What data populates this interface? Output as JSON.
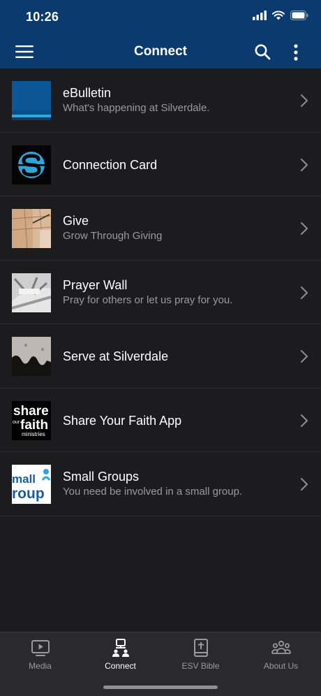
{
  "status": {
    "time": "10:26"
  },
  "header": {
    "title": "Connect"
  },
  "items": [
    {
      "title": "eBulletin",
      "subtitle": "What's happening at Silverdale."
    },
    {
      "title": "Connection Card",
      "subtitle": ""
    },
    {
      "title": "Give",
      "subtitle": "Grow Through Giving"
    },
    {
      "title": "Prayer Wall",
      "subtitle": "Pray for others or let us pray for you."
    },
    {
      "title": "Serve at Silverdale",
      "subtitle": ""
    },
    {
      "title": "Share Your Faith App",
      "subtitle": "",
      "thumb_text": [
        "share",
        "our",
        "faith",
        "ministries"
      ]
    },
    {
      "title": "Small Groups",
      "subtitle": "You need be involved in a small group.",
      "thumb_text": [
        "mall",
        "roup"
      ]
    }
  ],
  "tabs": [
    {
      "label": "Media",
      "icon": "play-icon"
    },
    {
      "label": "Connect",
      "icon": "connect-icon",
      "active": true
    },
    {
      "label": "ESV Bible",
      "icon": "bible-icon"
    },
    {
      "label": "About Us",
      "icon": "people-icon"
    }
  ],
  "colors": {
    "header": "#0a3a6e",
    "background": "#1c1c1e",
    "tabbar": "#2a2a2c"
  }
}
